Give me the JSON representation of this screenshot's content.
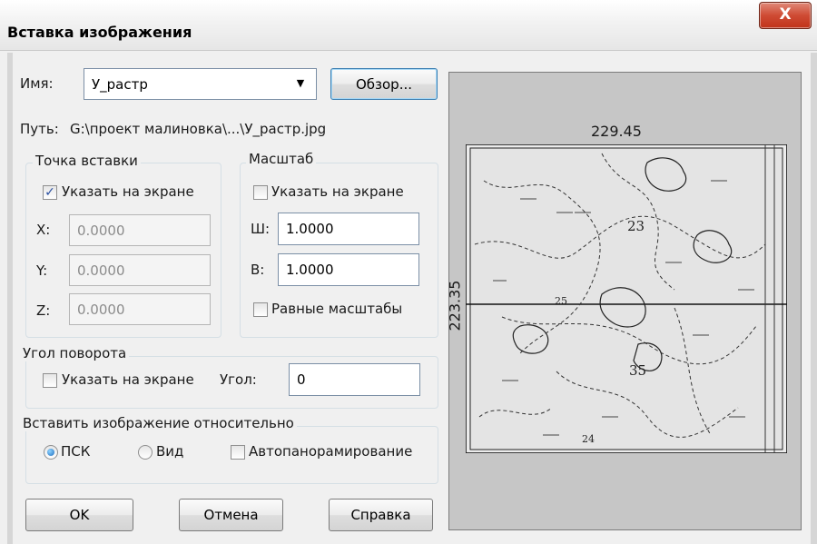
{
  "window": {
    "title": "Вставка изображения",
    "close_glyph": "X"
  },
  "name_row": {
    "label": "Имя:",
    "value": "У_растр",
    "browse_label": "Обзор..."
  },
  "path_row": {
    "label": "Путь:",
    "value": "G:\\проект малиновка\\...\\У_растр.jpg"
  },
  "insertion_point": {
    "legend": "Точка вставки",
    "specify_on_screen": {
      "label": "Указать на экране",
      "checked": true
    },
    "fields": [
      {
        "label": "X:",
        "value": "0.0000"
      },
      {
        "label": "Y:",
        "value": "0.0000"
      },
      {
        "label": "Z:",
        "value": "0.0000"
      }
    ]
  },
  "scale": {
    "legend": "Масштаб",
    "specify_on_screen": {
      "label": "Указать на экране",
      "checked": false
    },
    "fields": [
      {
        "label": "Ш:",
        "value": "1.0000"
      },
      {
        "label": "В:",
        "value": "1.0000"
      }
    ],
    "uniform": {
      "label": "Равные масштабы",
      "checked": false
    }
  },
  "rotation": {
    "legend": "Угол поворота",
    "specify_on_screen": {
      "label": "Указать на экране",
      "checked": false
    },
    "angle_label": "Угол:",
    "angle_value": "0"
  },
  "relative": {
    "legend": "Вставить изображение относительно",
    "options": [
      {
        "label": "ПСК",
        "selected": true
      },
      {
        "label": "Вид",
        "selected": false
      }
    ],
    "autopan": {
      "label": "Автопанорамирование",
      "checked": false
    }
  },
  "buttons": {
    "ok": "OK",
    "cancel": "Отмена",
    "help": "Справка"
  },
  "preview": {
    "width_label": "229.45",
    "height_label": "223.35",
    "map_labels": [
      "23",
      "35",
      "24",
      "25"
    ]
  },
  "icons": {
    "close": "close-icon",
    "dropdown": "chevron-down-icon",
    "check": "checkmark-icon"
  }
}
